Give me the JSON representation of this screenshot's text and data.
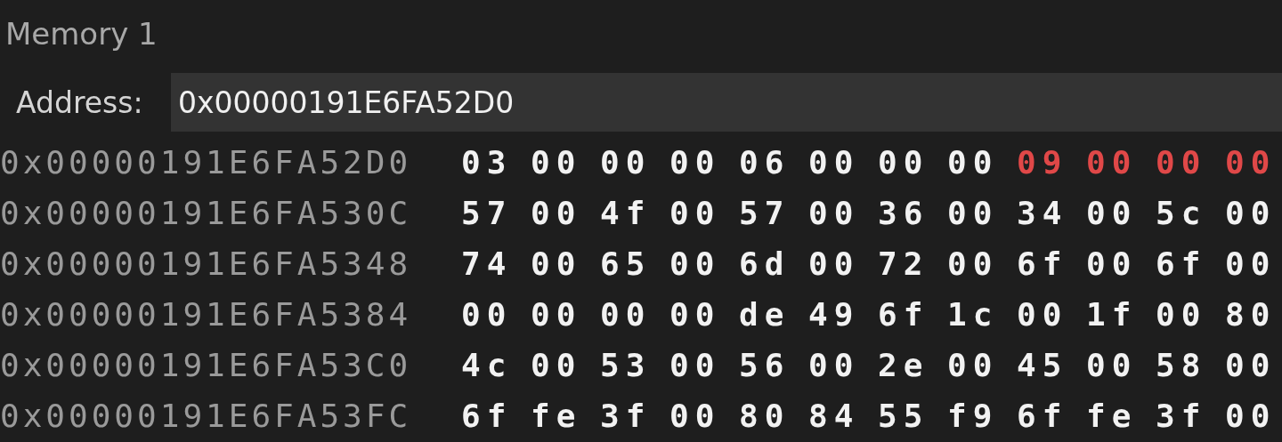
{
  "window": {
    "title": "Memory 1"
  },
  "address_bar": {
    "label": "Address:",
    "value": "0x00000191E6FA52D0"
  },
  "rows": [
    {
      "address": "0x00000191E6FA52D0",
      "bytes": [
        {
          "text": "03",
          "changed": false
        },
        {
          "text": "00",
          "changed": false
        },
        {
          "text": "00",
          "changed": false
        },
        {
          "text": "00",
          "changed": false
        },
        {
          "text": "06",
          "changed": false
        },
        {
          "text": "00",
          "changed": false
        },
        {
          "text": "00",
          "changed": false
        },
        {
          "text": "00",
          "changed": false
        },
        {
          "text": "09",
          "changed": true
        },
        {
          "text": "00",
          "changed": true
        },
        {
          "text": "00",
          "changed": true
        },
        {
          "text": "00",
          "changed": true
        }
      ]
    },
    {
      "address": "0x00000191E6FA530C",
      "bytes": [
        {
          "text": "57",
          "changed": false
        },
        {
          "text": "00",
          "changed": false
        },
        {
          "text": "4f",
          "changed": false
        },
        {
          "text": "00",
          "changed": false
        },
        {
          "text": "57",
          "changed": false
        },
        {
          "text": "00",
          "changed": false
        },
        {
          "text": "36",
          "changed": false
        },
        {
          "text": "00",
          "changed": false
        },
        {
          "text": "34",
          "changed": false
        },
        {
          "text": "00",
          "changed": false
        },
        {
          "text": "5c",
          "changed": false
        },
        {
          "text": "00",
          "changed": false
        }
      ]
    },
    {
      "address": "0x00000191E6FA5348",
      "bytes": [
        {
          "text": "74",
          "changed": false
        },
        {
          "text": "00",
          "changed": false
        },
        {
          "text": "65",
          "changed": false
        },
        {
          "text": "00",
          "changed": false
        },
        {
          "text": "6d",
          "changed": false
        },
        {
          "text": "00",
          "changed": false
        },
        {
          "text": "72",
          "changed": false
        },
        {
          "text": "00",
          "changed": false
        },
        {
          "text": "6f",
          "changed": false
        },
        {
          "text": "00",
          "changed": false
        },
        {
          "text": "6f",
          "changed": false
        },
        {
          "text": "00",
          "changed": false
        }
      ]
    },
    {
      "address": "0x00000191E6FA5384",
      "bytes": [
        {
          "text": "00",
          "changed": false
        },
        {
          "text": "00",
          "changed": false
        },
        {
          "text": "00",
          "changed": false
        },
        {
          "text": "00",
          "changed": false
        },
        {
          "text": "de",
          "changed": false
        },
        {
          "text": "49",
          "changed": false
        },
        {
          "text": "6f",
          "changed": false
        },
        {
          "text": "1c",
          "changed": false
        },
        {
          "text": "00",
          "changed": false
        },
        {
          "text": "1f",
          "changed": false
        },
        {
          "text": "00",
          "changed": false
        },
        {
          "text": "80",
          "changed": false
        }
      ]
    },
    {
      "address": "0x00000191E6FA53C0",
      "bytes": [
        {
          "text": "4c",
          "changed": false
        },
        {
          "text": "00",
          "changed": false
        },
        {
          "text": "53",
          "changed": false
        },
        {
          "text": "00",
          "changed": false
        },
        {
          "text": "56",
          "changed": false
        },
        {
          "text": "00",
          "changed": false
        },
        {
          "text": "2e",
          "changed": false
        },
        {
          "text": "00",
          "changed": false
        },
        {
          "text": "45",
          "changed": false
        },
        {
          "text": "00",
          "changed": false
        },
        {
          "text": "58",
          "changed": false
        },
        {
          "text": "00",
          "changed": false
        }
      ]
    },
    {
      "address": "0x00000191E6FA53FC",
      "bytes": [
        {
          "text": "6f",
          "changed": false
        },
        {
          "text": "fe",
          "changed": false
        },
        {
          "text": "3f",
          "changed": false
        },
        {
          "text": "00",
          "changed": false
        },
        {
          "text": "80",
          "changed": false
        },
        {
          "text": "84",
          "changed": false
        },
        {
          "text": "55",
          "changed": false
        },
        {
          "text": "f9",
          "changed": false
        },
        {
          "text": "6f",
          "changed": false
        },
        {
          "text": "fe",
          "changed": false
        },
        {
          "text": "3f",
          "changed": false
        },
        {
          "text": "00",
          "changed": false
        }
      ]
    }
  ]
}
